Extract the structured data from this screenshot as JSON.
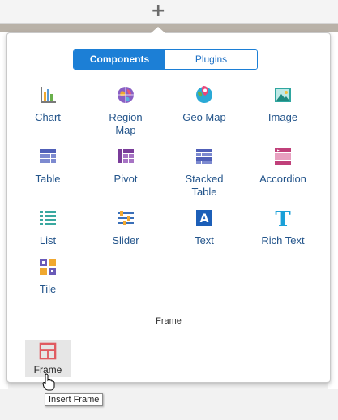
{
  "toolbar": {
    "add_icon": "plus-icon"
  },
  "tabs": {
    "active": "Components",
    "inactive": "Plugins"
  },
  "components": [
    {
      "label": "Chart",
      "icon": "bar-chart-icon"
    },
    {
      "label": "Region\nMap",
      "icon": "globe-icon"
    },
    {
      "label": "Geo Map",
      "icon": "geo-map-icon"
    },
    {
      "label": "Image",
      "icon": "image-icon"
    },
    {
      "label": "Table",
      "icon": "table-icon"
    },
    {
      "label": "Pivot",
      "icon": "pivot-icon"
    },
    {
      "label": "Stacked\nTable",
      "icon": "stacked-table-icon"
    },
    {
      "label": "Accordion",
      "icon": "accordion-icon"
    },
    {
      "label": "List",
      "icon": "list-icon"
    },
    {
      "label": "Slider",
      "icon": "slider-icon"
    },
    {
      "label": "Text",
      "icon": "text-icon"
    },
    {
      "label": "Rich Text",
      "icon": "rich-text-icon"
    },
    {
      "label": "Tile",
      "icon": "tile-icon"
    }
  ],
  "frame_section": {
    "title": "Frame",
    "item_label": "Frame",
    "tooltip": "Insert Frame"
  },
  "colors": {
    "accent": "#1c7fd6",
    "label": "#24558b"
  }
}
